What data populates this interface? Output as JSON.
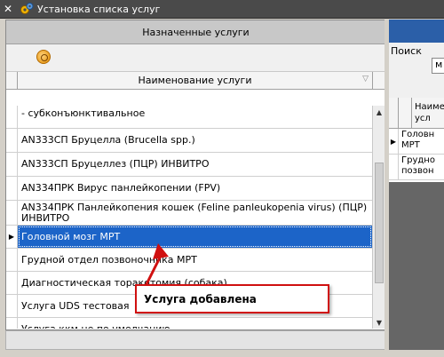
{
  "window": {
    "title": "Установка списка услуг",
    "close_glyph": "✕"
  },
  "left_panel": {
    "header": "Назначенные услуги",
    "column_header": "Наименование услуги",
    "sort_glyph": "▽",
    "rows": [
      {
        "text": "- субконъюнктивальное",
        "selected": false
      },
      {
        "text": "АN333СП Бруцелла (Brucella spp.)",
        "selected": false
      },
      {
        "text": "АN333СП Бруцеллез (ПЦР) ИНВИТРО",
        "selected": false
      },
      {
        "text": "АN334ПРК Вирус панлейкопении (FPV)",
        "selected": false
      },
      {
        "text": "АN334ПРК Панлейкопения кошек (Feline panleukopenia virus) (ПЦР) ИНВИТРО",
        "selected": false
      },
      {
        "text": "Головной мозг МРТ",
        "selected": true
      },
      {
        "text": "Грудной отдел позвоночника МРТ",
        "selected": false
      },
      {
        "text": "Диагностическая торакотомия (собака)",
        "selected": false
      },
      {
        "text": "Услуга UDS тестовая",
        "selected": false
      },
      {
        "text": "Услуга ккм не по умолчанию",
        "selected": false
      }
    ]
  },
  "right_panel": {
    "search_label": "Поиск",
    "search_value": "м",
    "column_header": "Наиме\nусл",
    "rows": [
      {
        "text": "Головн\nМРТ",
        "current": true
      },
      {
        "text": "Грудно\nпозвон",
        "current": false
      }
    ]
  },
  "callout": {
    "text": "Услуга добавлена",
    "border_color": "#d01010"
  },
  "colors": {
    "selection": "#1c64c8",
    "titlebar": "#4a4a4a",
    "right_header": "#2b5fa8"
  }
}
